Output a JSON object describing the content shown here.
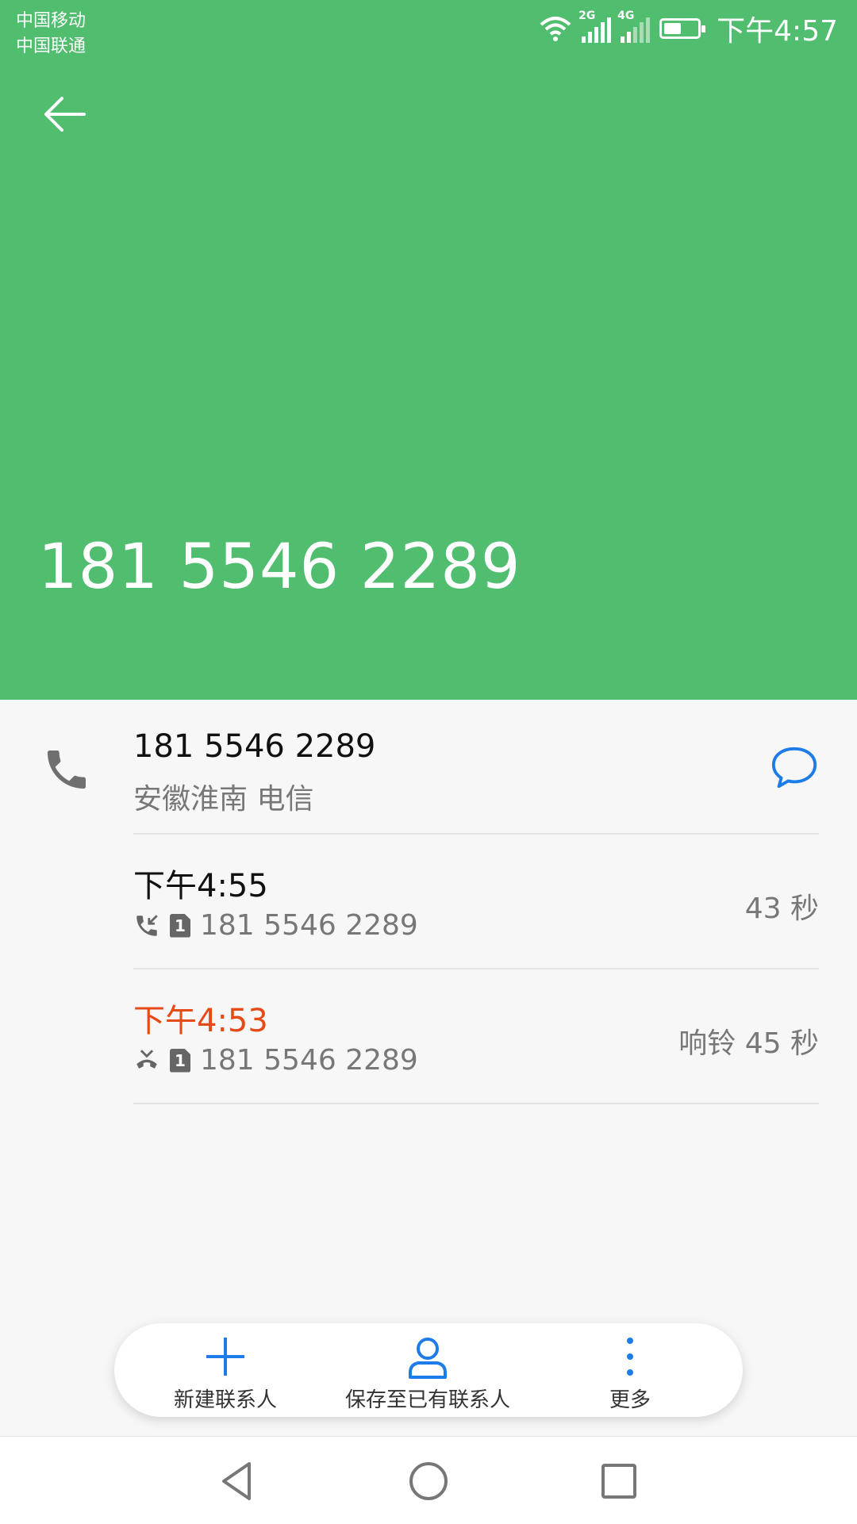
{
  "status_bar": {
    "carrier_1": "中国移动",
    "carrier_2": "中国联通",
    "network_1": "2G",
    "network_2": "4G",
    "time": "下午4:57"
  },
  "header": {
    "title_number": "181 5546 2289",
    "color": "#50bd6f"
  },
  "contact_row": {
    "number": "181 5546 2289",
    "location": "安徽淮南 电信",
    "icon": "phone-icon",
    "action_icon": "message-icon"
  },
  "call_log": [
    {
      "time": "下午4:55",
      "type": "incoming",
      "sim": "1",
      "number": "181 5546 2289",
      "duration": "43 秒",
      "time_color": "#111111"
    },
    {
      "time": "下午4:53",
      "type": "missed",
      "sim": "1",
      "number": "181 5546 2289",
      "duration": "响铃 45 秒",
      "time_color": "#e64a19"
    }
  ],
  "actions": [
    {
      "label": "新建联系人",
      "icon": "plus-icon"
    },
    {
      "label": "保存至已有联系人",
      "icon": "person-icon"
    },
    {
      "label": "更多",
      "icon": "more-vert-icon"
    }
  ],
  "accent_color": "#1e7ce8",
  "navbar": {
    "back": "nav-back-icon",
    "home": "nav-home-icon",
    "recents": "nav-recents-icon"
  }
}
